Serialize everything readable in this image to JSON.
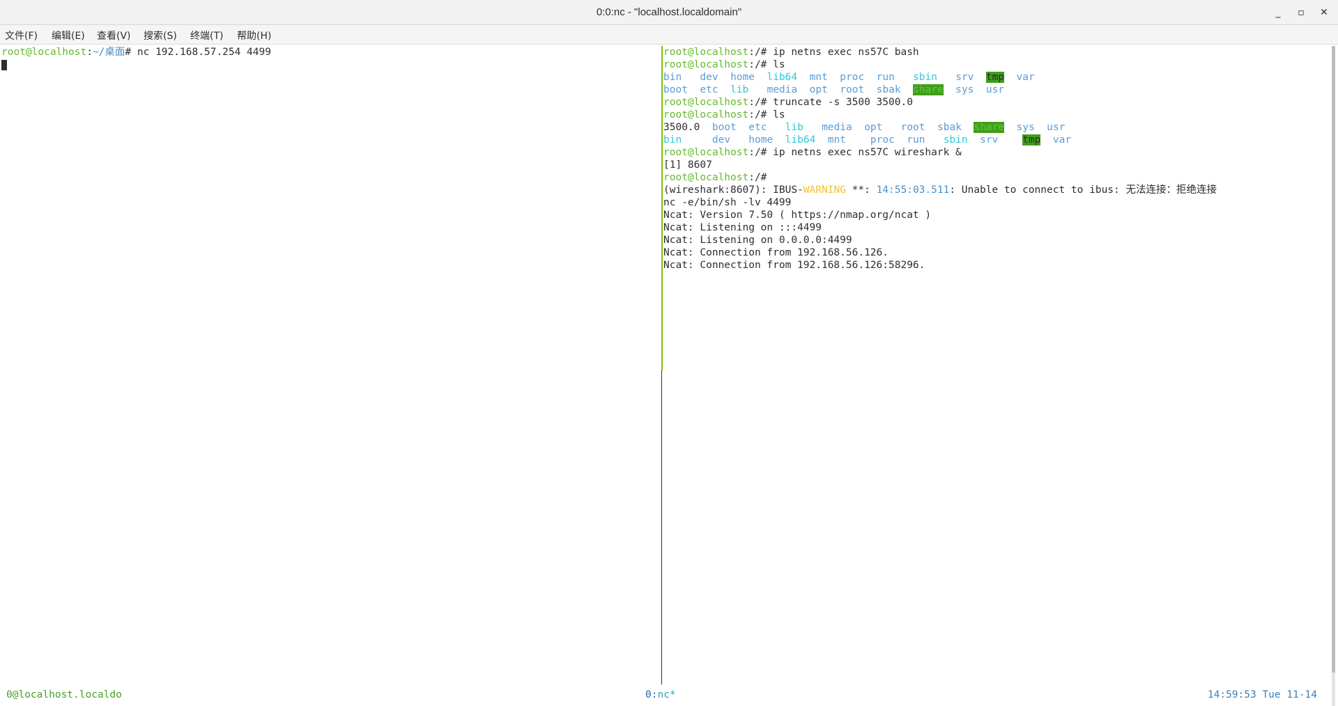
{
  "window": {
    "title": "0:0:nc - \"localhost.localdomain\"",
    "controls": {
      "minimize": "_",
      "maximize": "▫",
      "close": "✕"
    }
  },
  "menu": [
    "文件(F)",
    "编辑(E)",
    "查看(V)",
    "搜索(S)",
    "终端(T)",
    "帮助(H)"
  ],
  "left_pane": {
    "prompt_user": "root@localhost",
    "prompt_sep": ":",
    "prompt_path": "~/桌面",
    "prompt_end": "# ",
    "command": "nc 192.168.57.254 4499"
  },
  "right_pane": {
    "prompt_user": "root@localhost",
    "prompt_path": ":/# ",
    "cmd1": "ip netns exec ns57C bash",
    "cmd2": "ls",
    "ls1_row1": [
      "bin",
      "dev",
      "home",
      "lib64",
      "mnt",
      "proc",
      "run",
      "sbin",
      "srv",
      "tmp",
      "var"
    ],
    "ls1_row2": [
      "boot",
      "etc",
      "lib",
      "media",
      "opt",
      "root",
      "sbak",
      "share",
      "sys",
      "usr"
    ],
    "cmd3": "truncate -s 3500 3500.0",
    "cmd4": "ls",
    "ls2_row1": [
      "3500.0",
      "boot",
      "etc",
      "lib",
      "media",
      "opt",
      "root",
      "sbak",
      "share",
      "sys",
      "usr"
    ],
    "ls2_row2": [
      "bin",
      "dev",
      "home",
      "lib64",
      "mnt",
      "proc",
      "run",
      "sbin",
      "srv",
      "tmp",
      "var"
    ],
    "cmd5": "ip netns exec ns57C wireshark &",
    "job": "[1] 8607",
    "warn_prefix": "(wireshark:8607): IBUS-",
    "warn_word": "WARNING",
    "warn_stars": " **: ",
    "warn_time": "14:55:03.511",
    "warn_msg": ": Unable to connect to ibus: 无法连接：拒绝连接",
    "nc_cmd": "nc -e/bin/sh -lv 4499",
    "ncat1": "Ncat: Version 7.50 ( https://nmap.org/ncat )",
    "ncat2": "Ncat: Listening on :::4499",
    "ncat3": "Ncat: Listening on 0.0.0.0:4499",
    "ncat4": "Ncat: Connection from 192.168.56.126.",
    "ncat5": "Ncat: Connection from 192.168.56.126:58296."
  },
  "statusbar": {
    "left": "0@localhost.localdo",
    "middle_index": "0:",
    "middle_window": "nc*",
    "right": "14:59:53 Tue 11-14"
  },
  "colors": {
    "prompt_green": "#66b82e",
    "dir_blue": "#5b9bd5",
    "dir_cyan": "#2ec8d8",
    "highlight_green": "#3f9f1a",
    "warning_yellow": "#f0c23a",
    "status_green": "#45a025"
  }
}
